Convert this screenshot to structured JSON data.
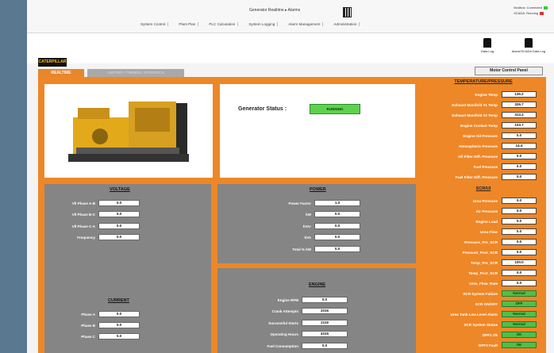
{
  "header": {
    "title": "Generator Realtime ▸ Alarms",
    "status_lines": [
      "Modbus: Connected",
      "SCADA: Running"
    ]
  },
  "menu": [
    "System Control",
    "Plant Plan",
    "PLC Calculation",
    "System Logging",
    "Alarm Management",
    "Administration"
  ],
  "toolbar": {
    "data_log": "Data Log",
    "alarm_log": "Alarm/SCADA Data Log",
    "motor_control": "Motor Control Panel"
  },
  "brand": "CATERPILLAR",
  "tabs": {
    "active": "REALTIME",
    "inactive": "HISTORY / TRENDS / STATISTICS"
  },
  "generator": {
    "label": "Generator Status :",
    "status": "RUNNING"
  },
  "temperature": {
    "title": "TEMPERATURE/PRESSURE",
    "rows": [
      {
        "label": "Engine Temp",
        "value": "126.2"
      },
      {
        "label": "Exhaust Manifold #1 Temp",
        "value": "326.7"
      },
      {
        "label": "Exhaust Manifold #2 Temp",
        "value": "313.2"
      },
      {
        "label": "Engine Coolant Temp",
        "value": "103.7"
      },
      {
        "label": "Engine Oil Pressure",
        "value": "0.0"
      },
      {
        "label": "Atmospheric Pressure",
        "value": "14.4"
      },
      {
        "label": "Oil Filter Diff. Pressure",
        "value": "0.0"
      },
      {
        "label": "Fuel Pressure",
        "value": "0.0"
      },
      {
        "label": "Fuel Filter Diff. Pressure",
        "value": "0.0"
      }
    ]
  },
  "scr": {
    "title": "SCR/UI",
    "rows": [
      {
        "label": "Urea Pressure",
        "value": "0.0",
        "state": "normal"
      },
      {
        "label": "Air Pressure",
        "value": "0.0",
        "state": "normal"
      },
      {
        "label": "Engine Load",
        "value": "0.0",
        "state": "normal"
      },
      {
        "label": "Urea Flow",
        "value": "0.0",
        "state": "normal"
      },
      {
        "label": "Pressure_Pre_SCR",
        "value": "0.0",
        "state": "normal"
      },
      {
        "label": "Pressure_Post_SCR",
        "value": "0.0",
        "state": "normal"
      },
      {
        "label": "Temp_Pre_SCR",
        "value": "100.0",
        "state": "normal"
      },
      {
        "label": "Temp_Post_SCR",
        "value": "0.0",
        "state": "normal"
      },
      {
        "label": "Urea_Flow_Rate",
        "value": "0.0",
        "state": "normal"
      },
      {
        "label": "SCR System Failure",
        "value": "Normal",
        "state": "ok"
      },
      {
        "label": "SCR ON/OFF",
        "value": "OFF",
        "state": "ok"
      },
      {
        "label": "Urea Tank Low Level Alarm",
        "value": "Normal",
        "state": "ok"
      },
      {
        "label": "SCR System Status",
        "value": "Normal",
        "state": "ok"
      },
      {
        "label": "DPF1 Ok",
        "value": "OK",
        "state": "ok"
      },
      {
        "label": "DPF2 Fault",
        "value": "OK",
        "state": "ok"
      }
    ]
  },
  "voltage": {
    "title": "VOLTAGE",
    "rows": [
      {
        "label": "Vll Phase A-B",
        "value": "0.0"
      },
      {
        "label": "Vll Phase B-C",
        "value": "0.0"
      },
      {
        "label": "Vll Phase C-A",
        "value": "0.0"
      },
      {
        "label": "Frequency",
        "value": "0.0"
      }
    ]
  },
  "power": {
    "title": "POWER",
    "rows": [
      {
        "label": "Power Factor",
        "value": "1.0"
      },
      {
        "label": "kW",
        "value": "0.0"
      },
      {
        "label": "kVAr",
        "value": "0.0"
      },
      {
        "label": "kVA",
        "value": "0.0"
      },
      {
        "label": "Total % kW",
        "value": "0.0"
      }
    ]
  },
  "current": {
    "title": "CURRENT",
    "rows": [
      {
        "label": "Phase A",
        "value": "0.0"
      },
      {
        "label": "Phase B",
        "value": "0.0"
      },
      {
        "label": "Phase C",
        "value": "0.0"
      }
    ]
  },
  "engine": {
    "title": "ENGINE",
    "rows": [
      {
        "label": "Engine RPM",
        "value": "0.0"
      },
      {
        "label": "Crank Attempts",
        "value": "2016"
      },
      {
        "label": "Successful Starts",
        "value": "2119"
      },
      {
        "label": "Operating Hours",
        "value": "4315"
      },
      {
        "label": "Fuel Consumption",
        "value": "0.0"
      }
    ]
  },
  "colors": {
    "accent": "#ee8727",
    "ok": "#4fc04a",
    "panel": "#858585"
  }
}
